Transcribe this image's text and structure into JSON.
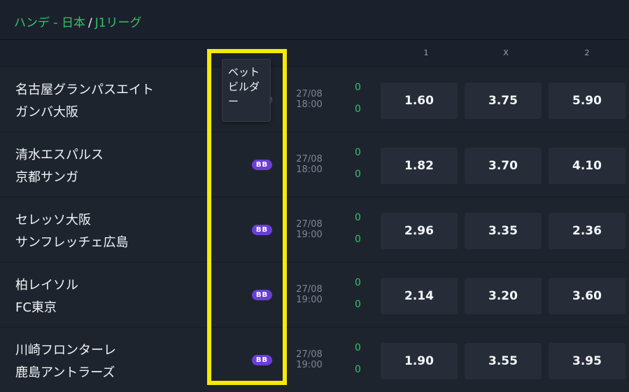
{
  "breadcrumb": {
    "items": [
      "ハンデ - 日本",
      "J1リーグ"
    ],
    "separator": "/"
  },
  "columns": [
    "1",
    "X",
    "2"
  ],
  "tooltip": {
    "text": "ベットビルダー"
  },
  "bb_label": "BB",
  "matches": [
    {
      "home": "名古屋グランパスエイト",
      "away": "ガンバ大阪",
      "date": "27/08",
      "time": "18:00",
      "score_home": "0",
      "score_away": "0",
      "odds": [
        "1.60",
        "3.75",
        "5.90"
      ],
      "bet_builder": true
    },
    {
      "home": "清水エスパルス",
      "away": "京都サンガ",
      "date": "27/08",
      "time": "18:00",
      "score_home": "0",
      "score_away": "0",
      "odds": [
        "1.82",
        "3.70",
        "4.10"
      ],
      "bet_builder": true
    },
    {
      "home": "セレッソ大阪",
      "away": "サンフレッチェ広島",
      "date": "27/08",
      "time": "19:00",
      "score_home": "0",
      "score_away": "0",
      "odds": [
        "2.96",
        "3.35",
        "2.36"
      ],
      "bet_builder": true
    },
    {
      "home": "柏レイソル",
      "away": "FC東京",
      "date": "27/08",
      "time": "19:00",
      "score_home": "0",
      "score_away": "0",
      "odds": [
        "2.14",
        "3.20",
        "3.60"
      ],
      "bet_builder": true
    },
    {
      "home": "川崎フロンターレ",
      "away": "鹿島アントラーズ",
      "date": "27/08",
      "time": "19:00",
      "score_home": "0",
      "score_away": "0",
      "odds": [
        "1.90",
        "3.55",
        "3.95"
      ],
      "bet_builder": true
    }
  ],
  "colors": {
    "accent_green": "#31c46a",
    "bb_purple": "#6b3fd6",
    "highlight_yellow": "#f5ea06"
  }
}
